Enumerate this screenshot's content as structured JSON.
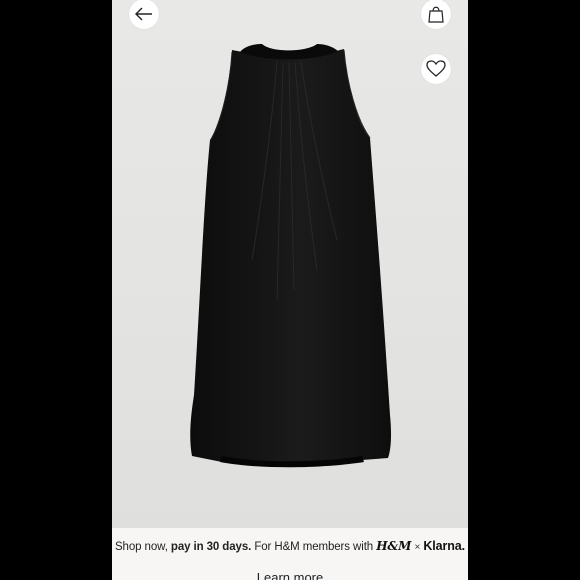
{
  "promo": {
    "prefix": "Shop now, ",
    "bold": "pay in 30 days.",
    "suffix": " For H&M members with ",
    "hm_logo": "H&M",
    "times": "×",
    "klarna_logo": "Klarna.",
    "learn_more": "Learn more"
  },
  "icons": {
    "back": "arrow-left-icon",
    "bag": "shopping-bag-icon",
    "heart": "heart-icon"
  },
  "product": {
    "color": "#111111"
  }
}
